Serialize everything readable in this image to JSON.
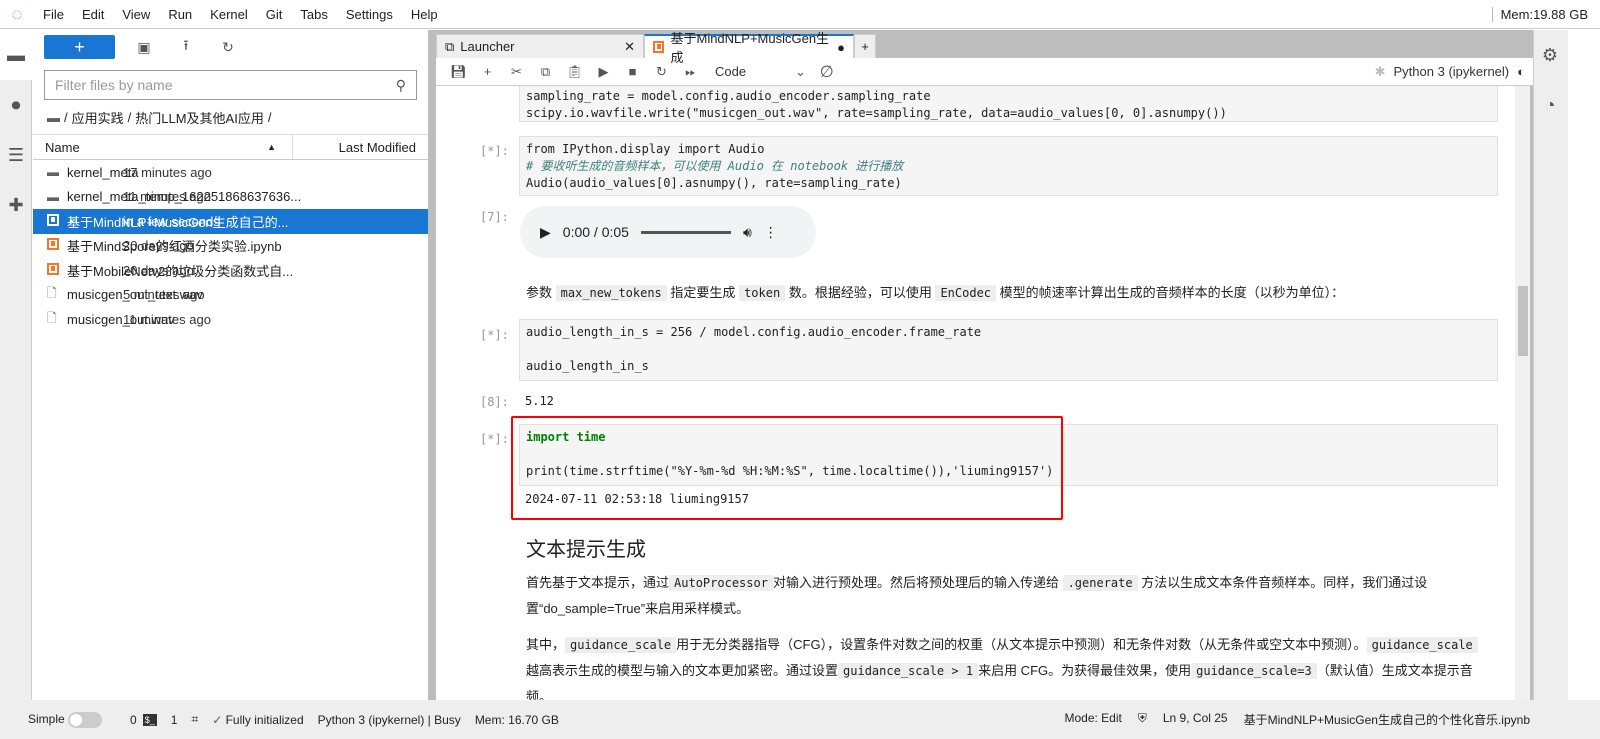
{
  "menubar": {
    "items": [
      "File",
      "Edit",
      "View",
      "Run",
      "Kernel",
      "Git",
      "Tabs",
      "Settings",
      "Help"
    ],
    "mem": "Mem:19.88 GB"
  },
  "filebrowser": {
    "new_label": "+",
    "filter_placeholder": "Filter files by name",
    "breadcrumb": [
      "/",
      "应用实践",
      "/",
      "热门LLM及其他AI应用",
      "/"
    ],
    "col_name": "Name",
    "col_modified": "Last Modified",
    "files": [
      {
        "name": "kernel_meta",
        "modified": "17 minutes ago",
        "type": "folder"
      },
      {
        "name": "kernel_meta_temp_162251868637636...",
        "modified": "11 minutes ago",
        "type": "folder"
      },
      {
        "name": "基于MindNLP+MusicGen生成自己的...",
        "modified": "in a few seconds",
        "type": "notebook",
        "selected": true
      },
      {
        "name": "基于MindSpore的红酒分类实验.ipynb",
        "modified": "20 days ago",
        "type": "notebook"
      },
      {
        "name": "基于MobileNetv2的垃圾分类函数式自...",
        "modified": "20 days ago",
        "type": "notebook"
      },
      {
        "name": "musicgen_out_text.wav",
        "modified": "5 minutes ago",
        "type": "file"
      },
      {
        "name": "musicgen_out.wav",
        "modified": "11 minutes ago",
        "type": "file"
      }
    ]
  },
  "tabs": [
    {
      "label": "Launcher"
    },
    {
      "label": "基于MindNLP+MusicGen生成"
    }
  ],
  "toolbar": {
    "cell_type": "Code",
    "kernel": "Python 3 (ipykernel)"
  },
  "notebook": {
    "cell0": [
      "sampling_rate = model.config.audio_encoder.sampling_rate",
      "scipy.io.wavfile.write(\"musicgen_out.wav\", rate=sampling_rate, data=audio_values[0, 0].asnumpy())"
    ],
    "cell1_prompt": "[*]:",
    "cell1": [
      "from IPython.display import Audio",
      "# 要收听生成的音频样本，可以使用 Audio 在 notebook 进行播放",
      "Audio(audio_values[0].asnumpy(), rate=sampling_rate)"
    ],
    "out7_prompt": "[7]:",
    "audio_time": "0:00 / 0:05",
    "md1": {
      "a": "参数",
      "c1": "max_new_tokens",
      "b": "指定要生成",
      "c2": "token",
      "c": "数。根据经验，可以使用",
      "c3": "EnCodec",
      "d": "模型的帧速率计算出生成的音频样本的长度（以秒为单位）："
    },
    "cell2_prompt": "[*]:",
    "cell2": [
      "audio_length_in_s = 256 / model.config.audio_encoder.frame_rate",
      "",
      "audio_length_in_s"
    ],
    "out8_prompt": "[8]:",
    "out8": "5.12",
    "cell3_prompt": "[*]:",
    "cell3": [
      "import time",
      "",
      "print(time.strftime(\"%Y-%m-%d %H:%M:%S\", time.localtime()),'liuming9157')"
    ],
    "out3": "2024-07-11 02:53:18 liuming9157",
    "heading": "文本提示生成",
    "p1": {
      "a": "首先基于文本提示，通过",
      "c1": "AutoProcessor",
      "b": "对输入进行预处理。然后将预处理后的输入传递给",
      "c2": ".generate",
      "c": "方法以生成文本条件音频样本。同样，我们通过设置“do_sample=True”来启用采样模式。"
    },
    "p2": {
      "a": "其中，",
      "c1": "guidance_scale",
      "b": "用于无分类器指导（CFG），设置条件对数之间的权重（从文本提示中预测）和无条件对数（从无条件或空文本中预测）。",
      "c2": "guidance_scale",
      "c": "越高表示生成的模型与输入的文本更加紧密。通过设置",
      "c3": "guidance_scale > 1",
      "d": "来启用 CFG。为获得最佳效果，使用",
      "c4": "guidance_scale=3",
      "e": "（默认值）生成文本提示音频。"
    }
  },
  "status": {
    "mode_label": "Simple",
    "terminals": "0",
    "kernels": "1",
    "init": "Fully initialized",
    "kernel_status": "Python 3 (ipykernel) | Busy",
    "mem": "Mem: 16.70 GB",
    "edit_mode": "Mode: Edit",
    "position": "Ln 9, Col 25",
    "filename": "基于MindNLP+MusicGen生成自己的个性化音乐.ipynb"
  },
  "colors": {
    "accent": "#1976d2",
    "notebook_icon": "#f37726",
    "highlight_box": "#ff0000"
  }
}
